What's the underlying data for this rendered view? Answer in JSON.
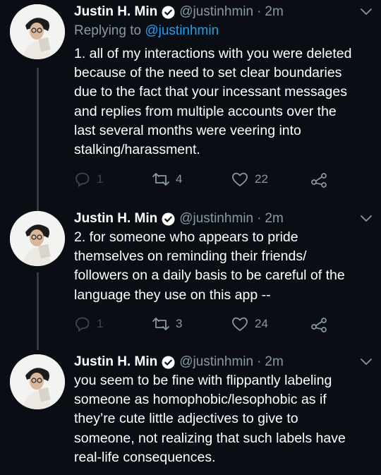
{
  "colors": {
    "background": "#0a0e14",
    "text": "#ffffff",
    "secondary": "#8899a6",
    "accent": "#1da1f2",
    "thread_line": "#2f3b47"
  },
  "tweets": [
    {
      "author_name": "Justin H. Min",
      "handle": "@justinhmin",
      "dot": "·",
      "time": "2m",
      "replying_prefix": "Replying to",
      "replying_to": "@justinhmin",
      "lines": [
        "1. all of my interactions with you were deleted",
        "because of the need to set clear boundaries",
        "due to the fact that your incessant messages",
        "and replies from multiple accounts over the",
        "last several months were veering into",
        "stalking/harassment."
      ],
      "replies": "1",
      "retweets": "4",
      "likes": "22",
      "icons": {
        "reply": "reply-icon",
        "retweet": "retweet-icon",
        "like": "heart-icon",
        "share": "share-icon",
        "menu": "chevron-down-icon",
        "badge": "verified-icon"
      }
    },
    {
      "author_name": "Justin H. Min",
      "handle": "@justinhmin",
      "dot": "·",
      "time": "2m",
      "lines": [
        "2. for someone who appears to pride",
        "themselves on reminding their friends/",
        "followers on a daily basis to be careful of the",
        "language they use on this app --"
      ],
      "replies": "1",
      "retweets": "3",
      "likes": "24"
    },
    {
      "author_name": "Justin H. Min",
      "handle": "@justinhmin",
      "dot": "·",
      "time": "2m",
      "lines": [
        "you seem to be fine with flippantly labeling",
        "someone as homophobic/lesophobic as if",
        "they’re cute little adjectives to give to",
        "someone, not realizing that such labels have",
        "real-life consequences."
      ]
    }
  ]
}
